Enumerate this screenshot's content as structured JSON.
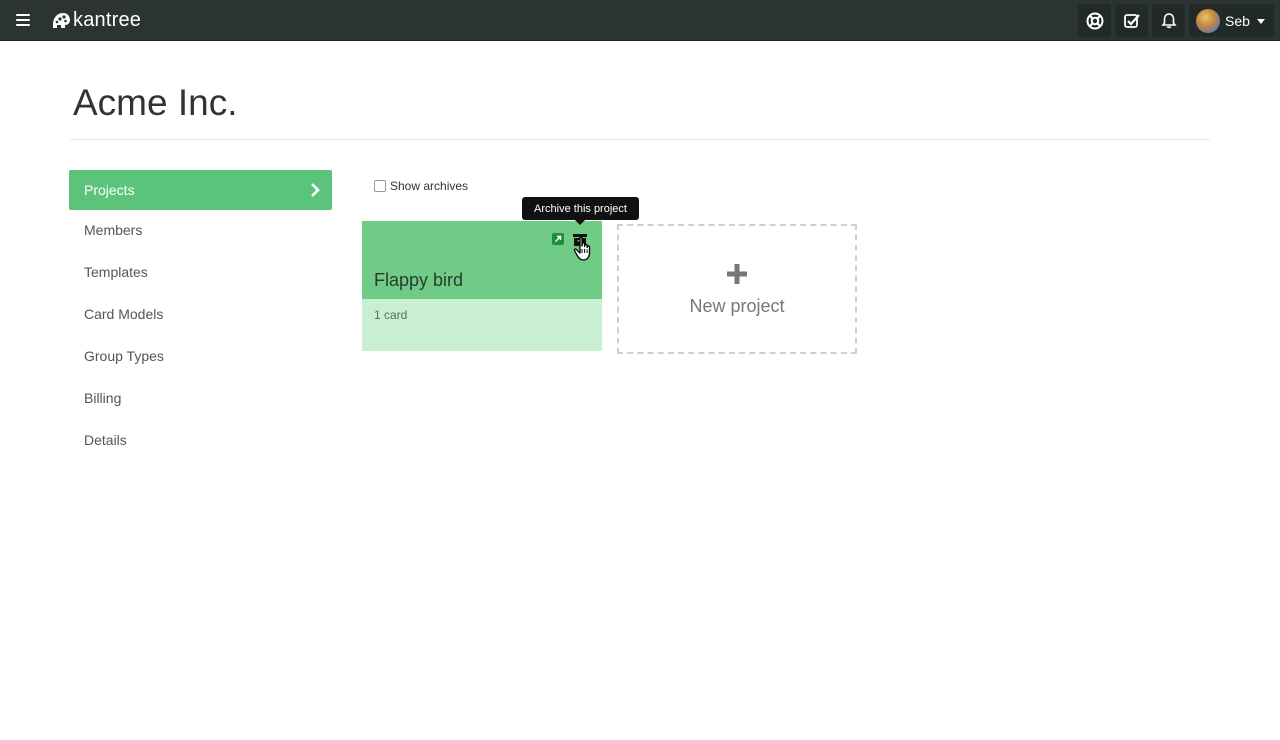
{
  "navbar": {
    "brand": "kantree",
    "icons": [
      "help-lifebuoy-icon",
      "tasks-check-icon",
      "bell-icon"
    ],
    "user_name": "Seb"
  },
  "page": {
    "title": "Acme Inc."
  },
  "sidebar": {
    "items": [
      {
        "label": "Projects",
        "active": true
      },
      {
        "label": "Members"
      },
      {
        "label": "Templates"
      },
      {
        "label": "Card Models"
      },
      {
        "label": "Group Types"
      },
      {
        "label": "Billing"
      },
      {
        "label": "Details"
      }
    ]
  },
  "main": {
    "show_archives_label": "Show archives",
    "show_archives_checked": false,
    "tooltip": "Archive this project",
    "projects": [
      {
        "title": "Flappy bird",
        "meta": "1 card",
        "color": "#6fcb86"
      }
    ],
    "new_project_label": "New project"
  },
  "colors": {
    "navbar": "#2b3431",
    "accent": "#5cc37a"
  }
}
